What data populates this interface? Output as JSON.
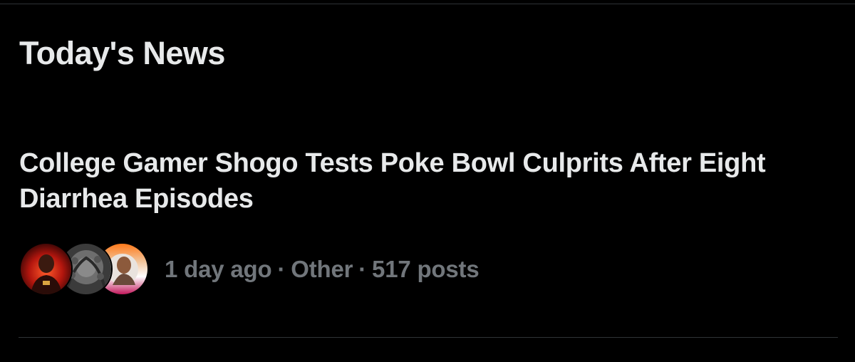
{
  "section": {
    "title": "Today's News"
  },
  "story": {
    "headline": "College Gamer Shogo Tests Poke Bowl Culprits After Eight Diarrhea Episodes",
    "time_ago": "1 day ago",
    "separator": "·",
    "category": "Other",
    "post_count": "517 posts",
    "avatars": [
      {
        "name": "avatar-1",
        "accent": "#c0392b"
      },
      {
        "name": "avatar-2",
        "accent": "#6b6b6b"
      },
      {
        "name": "avatar-3",
        "accent": "#e0467c"
      }
    ]
  },
  "colors": {
    "background": "#000000",
    "text_primary": "#e7e9ea",
    "text_secondary": "#71767b",
    "divider": "#2f3336"
  }
}
